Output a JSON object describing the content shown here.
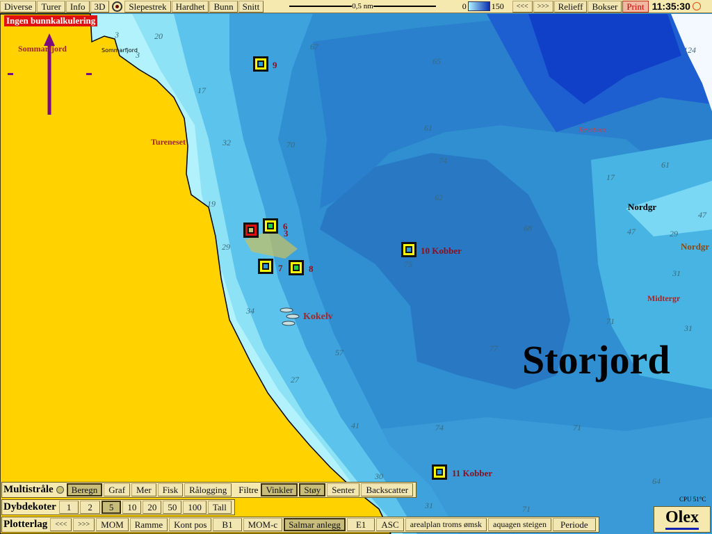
{
  "toolbar": {
    "items": [
      "Diverse",
      "Turer",
      "Info",
      "3D"
    ],
    "items2": [
      "Slepestrek",
      "Hardhet",
      "Bunn",
      "Snitt"
    ],
    "scale": "0,5 nm",
    "depth_min": "0",
    "depth_max": "150",
    "prev": "<<<",
    "next": ">>>",
    "relieff": "Relieff",
    "bokser": "Bokser",
    "print": "Print",
    "clock": "11:35:30"
  },
  "status": {
    "warning": "Ingen bunnkalkulering",
    "cpu": "CPU 51°C"
  },
  "map": {
    "places": [
      "Sommarfjord",
      "Sommarfjord",
      "Tureneset",
      "Revsbotn",
      "Nordgr",
      "Nordgr",
      "Midtergr",
      "Kokelv",
      "Storjord"
    ],
    "depths": [
      "3",
      "20",
      "3",
      "67",
      "124",
      "17",
      "65",
      "32",
      "70",
      "61",
      "74",
      "19",
      "62",
      "29",
      "17",
      "61",
      "47",
      "47",
      "29",
      "31",
      "31",
      "71",
      "75",
      "68",
      "34",
      "77",
      "57",
      "27",
      "41",
      "74",
      "71",
      "30",
      "31",
      "71",
      "64"
    ],
    "markers": [
      "9",
      "6",
      "3",
      "7",
      "8",
      "10 Kobber",
      "11 Kobber"
    ],
    "colors": {
      "land": "#ffd200",
      "shallow": "#a8f0f8",
      "deep": "#1040c8",
      "marker": "#ffff00",
      "alert": "#e01010"
    }
  },
  "multistrale": {
    "title": "Multistråle",
    "buttons": [
      {
        "label": "Beregn",
        "on": true
      },
      {
        "label": "Graf"
      },
      {
        "label": "Mer"
      },
      {
        "label": "Fisk"
      },
      {
        "label": "Rålogging"
      }
    ],
    "filter_label": "Filtre",
    "filters": [
      {
        "label": "Vinkler",
        "on": true
      },
      {
        "label": "Støy",
        "on": true
      },
      {
        "label": "Senter"
      },
      {
        "label": "Backscatter"
      }
    ]
  },
  "dybdekoter": {
    "title": "Dybdekoter",
    "buttons": [
      "1",
      "2",
      "5",
      "10",
      "20",
      "50",
      "100",
      "Tall"
    ],
    "selected": "5"
  },
  "plotterlag": {
    "title": "Plotterlag",
    "buttons": [
      "<<<",
      ">>>",
      "MOM",
      "Ramme",
      "Kont pos",
      "B1",
      "MOM-c",
      "Salmar anlegg",
      "E1",
      "ASC",
      "arealplan troms ømsk",
      "aquagen steigen",
      "Periode"
    ],
    "selected": "Salmar anlegg"
  },
  "logo": "Olex"
}
